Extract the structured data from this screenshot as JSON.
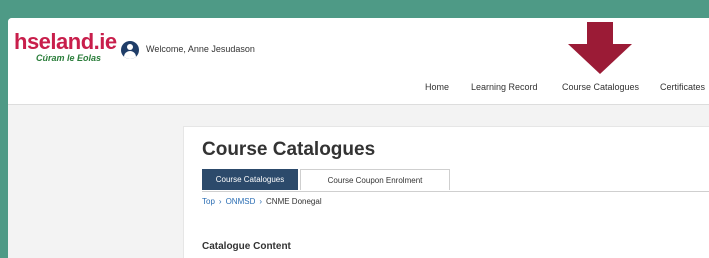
{
  "brand": {
    "name": "hseland.ie",
    "tagline": "Cúram le Eolas",
    "colors": {
      "primary": "#c81e4b",
      "tagline": "#2a7d3a",
      "frame": "#4e9a86",
      "tab_active": "#2c4a6b",
      "link": "#2a6db3",
      "arrow": "#9b1b36"
    }
  },
  "header": {
    "avatar_icon": "user-avatar-icon",
    "welcome_text": "Welcome, Anne Jesudason"
  },
  "nav": {
    "items": [
      {
        "label": "Home"
      },
      {
        "label": "Learning Record"
      },
      {
        "label": "Course Catalogues"
      },
      {
        "label": "Certificates"
      }
    ],
    "highlighted": "Course Catalogues",
    "indicator_icon": "down-arrow-icon"
  },
  "main": {
    "title": "Course Catalogues",
    "tabs": [
      {
        "label": "Course Catalogues",
        "active": true
      },
      {
        "label": "Course Coupon Enrolment",
        "active": false
      }
    ],
    "breadcrumb": [
      {
        "label": "Top"
      },
      {
        "label": "ONMSD"
      },
      {
        "label": "CNME Donegal"
      }
    ],
    "breadcrumb_separator": "›",
    "section_title": "Catalogue Content"
  }
}
